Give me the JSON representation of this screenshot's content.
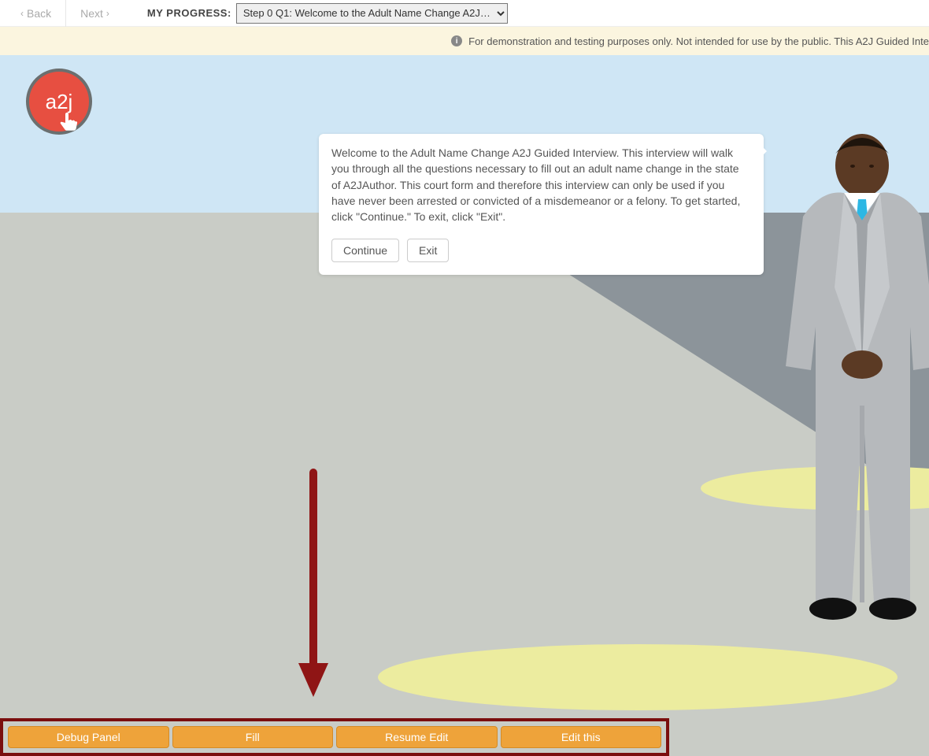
{
  "nav": {
    "back": "Back",
    "next": "Next",
    "progress_label": "MY PROGRESS:",
    "progress_value": "Step 0 Q1: Welcome to the Adult Name Change A2J…"
  },
  "banner": {
    "text": "For demonstration and testing purposes only. Not intended for use by the public. This A2J Guided Inte"
  },
  "logo": {
    "text": "a2j"
  },
  "bubble": {
    "text": "Welcome to the Adult Name Change A2J Guided Interview. This interview will walk you through all the questions necessary to fill out an adult name change in the state of A2JAuthor. This court form and therefore this interview can only be used if you have never been arrested or convicted of a misdemeanor or a felony. To get started, click \"Continue.\" To exit, click \"Exit\".",
    "continue": "Continue",
    "exit": "Exit"
  },
  "debug": {
    "panel": "Debug Panel",
    "fill": "Fill",
    "resume": "Resume Edit",
    "edit": "Edit this"
  },
  "colors": {
    "accent_orange": "#eea33a",
    "logo_red": "#e74f41",
    "highlight_border": "#7a0e0e",
    "tie_blue": "#2cb7e4"
  }
}
